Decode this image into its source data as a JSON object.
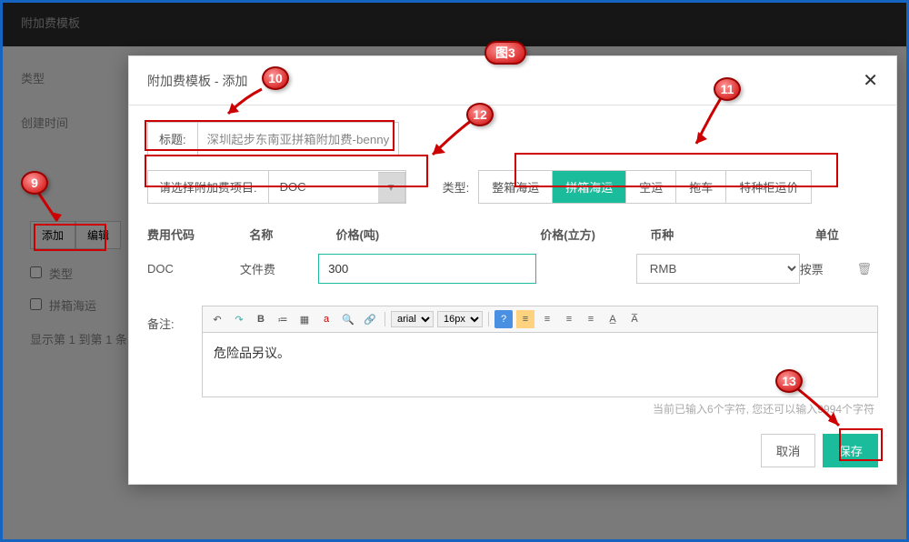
{
  "bg": {
    "header_title": "附加费模板",
    "sidebar": {
      "item1": "类型",
      "item2": "创建时间"
    },
    "toolbar": {
      "add": "添加",
      "edit": "编辑"
    },
    "list": {
      "item1": "类型",
      "item2": "拼箱海运"
    },
    "footer": "显示第 1 到第 1 条"
  },
  "modal": {
    "title": "附加费模板 - 添加",
    "title_label": "标题:",
    "title_value": "深圳起步东南亚拼箱附加费-benny",
    "select_fee_label": "请选择附加费项目:",
    "select_fee_value": "DOC",
    "type_label": "类型:",
    "type_options": [
      "整箱海运",
      "拼箱海运",
      "空运",
      "拖车",
      "特种柜运价"
    ],
    "type_active_index": 1,
    "table": {
      "headers": {
        "code": "费用代码",
        "name": "名称",
        "price_ton": "价格(吨)",
        "price_m3": "价格(立方)",
        "currency": "币种",
        "unit": "单位"
      },
      "row": {
        "code": "DOC",
        "name": "文件费",
        "price_ton": "300",
        "currency": "RMB",
        "unit": "按票"
      }
    },
    "remarks_label": "备注:",
    "editor": {
      "font": "arial",
      "size": "16px",
      "content": "危险品另议。"
    },
    "char_count": "当前已输入6个字符, 您还可以输入9994个字符",
    "cancel": "取消",
    "save": "保存"
  },
  "annotations": {
    "label_9": "9",
    "label_10": "10",
    "label_11": "11",
    "label_12": "12",
    "label_13": "13",
    "label_fig": "图3"
  }
}
